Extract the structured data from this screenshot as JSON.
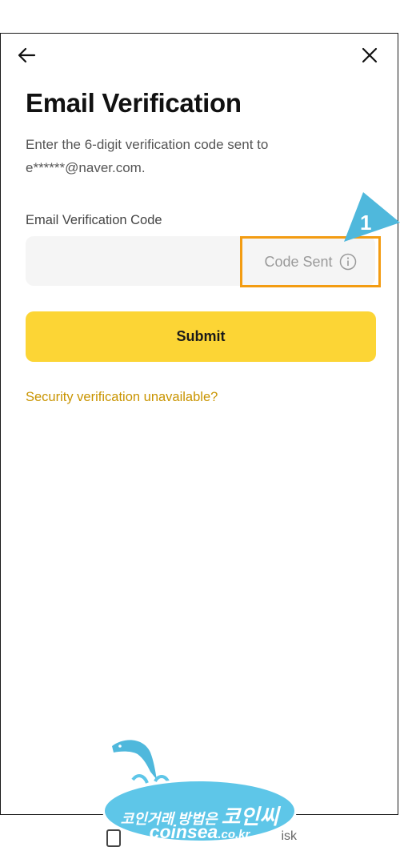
{
  "header": {
    "back_icon": "arrow-left-icon",
    "close_icon": "close-icon"
  },
  "page": {
    "title": "Email Verification",
    "description": "Enter the 6-digit verification code sent to e******@naver.com."
  },
  "form": {
    "field_label": "Email Verification Code",
    "code_value": "",
    "code_sent_label": "Code Sent",
    "info_icon": "info-icon",
    "submit_label": "Submit",
    "unavailable_link": "Security verification unavailable?"
  },
  "annotation": {
    "marker_number": "1",
    "highlight_color": "#f39c12",
    "marker_color": "#4fb8dc"
  },
  "bottom_hint": {
    "text_fragment": "isk"
  },
  "watermark": {
    "korean_small": "코인거래 방법은 ",
    "korean_big": "코인씨",
    "domain_main": "coinsea",
    "domain_tld": ".co.kr"
  },
  "colors": {
    "primary": "#fcd535",
    "link": "#c99400",
    "input_bg": "#f5f5f5"
  }
}
